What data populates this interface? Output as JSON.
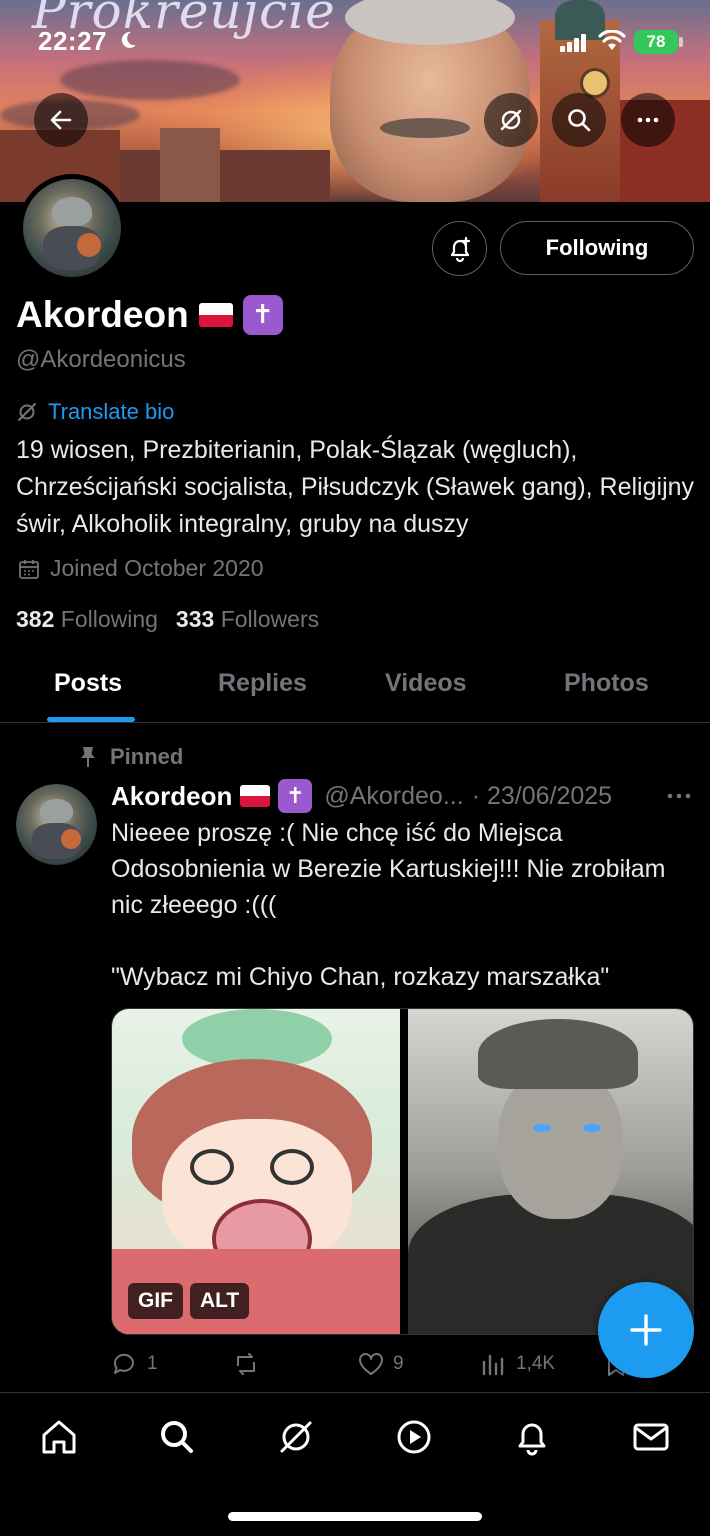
{
  "banner": {
    "script_text": "Prokreujcie"
  },
  "status": {
    "time": "22:27",
    "battery": "78"
  },
  "profile": {
    "name": "Akordeon",
    "handle": "@Akordeonicus",
    "follow_label": "Following",
    "translate_label": "Translate bio",
    "bio": "19 wiosen, Prezbiterianin, Polak-Ślązak (węgluch), Chrześcijański socjalista, Piłsudczyk (Sławek gang), Religijny świr, Alkoholik integralny, gruby na duszy",
    "joined": "Joined October 2020",
    "following_count": "382",
    "following_label": "Following",
    "followers_count": "333",
    "followers_label": "Followers"
  },
  "tabs": [
    {
      "label": "Posts"
    },
    {
      "label": "Replies"
    },
    {
      "label": "Videos"
    },
    {
      "label": "Photos"
    }
  ],
  "post": {
    "pinned_label": "Pinned",
    "name": "Akordeon",
    "handle": "@Akordeo...",
    "date": "· 23/06/2025",
    "text": "Nieeee proszę :( Nie chcę iść do Miejsca Odosobnienia w Berezie Kartuskiej!!! Nie zrobiłam nic złeeego :(((\n\n\"Wybacz mi Chiyo Chan, rozkazy marszałka\"",
    "badges": {
      "gif": "GIF",
      "alt": "ALT"
    },
    "replies": "1",
    "reposts": "",
    "likes": "9",
    "views": "1,4K"
  },
  "colors": {
    "accent": "#1d9bf0",
    "background": "#000000",
    "muted": "#71767b",
    "badge_purple": "#9b59d0"
  }
}
